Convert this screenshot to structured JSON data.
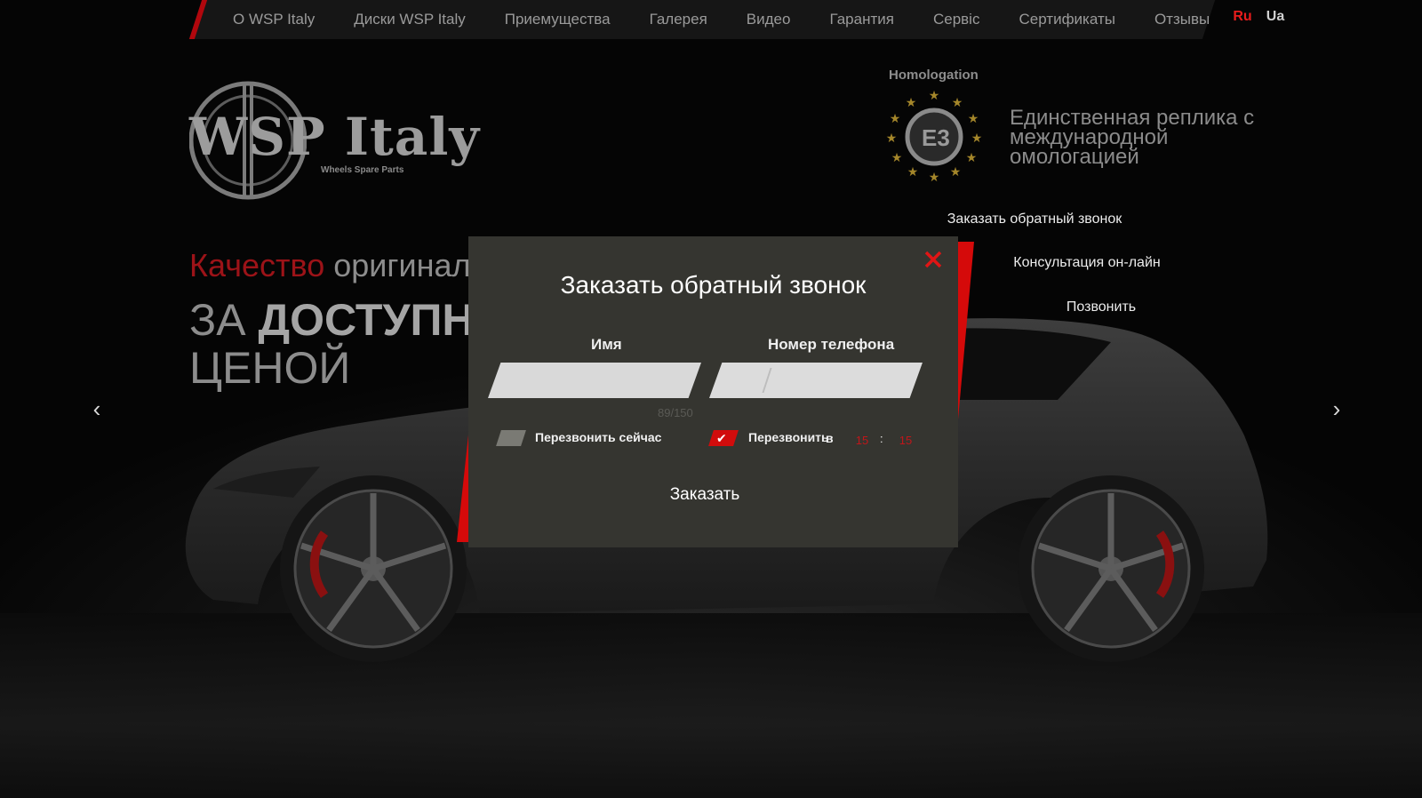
{
  "nav": {
    "items": [
      "О WSP Italy",
      "Диски WSP Italy",
      "Приемущества",
      "Галерея",
      "Видео",
      "Гарантия",
      "Сервiс",
      "Сертификаты",
      "Отзывы"
    ],
    "lang_ru": "Ru",
    "lang_ua": "Ua"
  },
  "logo": {
    "text": "WSP Italy",
    "subtitle": "Wheels Spare Parts"
  },
  "homologation": {
    "label": "Homologation",
    "badge_text": "E3",
    "tagline": "Единственная реплика с международной омологацией"
  },
  "side_buttons": [
    "Заказать обратный звонок",
    "Консультация он-лайн",
    "Позвонить"
  ],
  "hero": {
    "line1_red": "Качество",
    "line1_rest": " оригинала",
    "line2_prefix": "ЗА ",
    "line2_bold": "ДОСТУПН",
    "line3": "ЦЕНОЙ"
  },
  "modal": {
    "title": "Заказать обратный звонок",
    "name_label": "Имя",
    "phone_label": "Номер телефона",
    "name_value": "",
    "phone_value": "",
    "counter": "89/150",
    "callback_now": "Перезвонить сейчас",
    "callback_at": "Перезвонить",
    "callback_at_suffix": "в",
    "hour": "15",
    "minute": "15",
    "submit": "Заказать"
  },
  "colors": {
    "accent": "#d50b0b",
    "modal_bg": "#353530",
    "nav_bg": "#161616"
  }
}
